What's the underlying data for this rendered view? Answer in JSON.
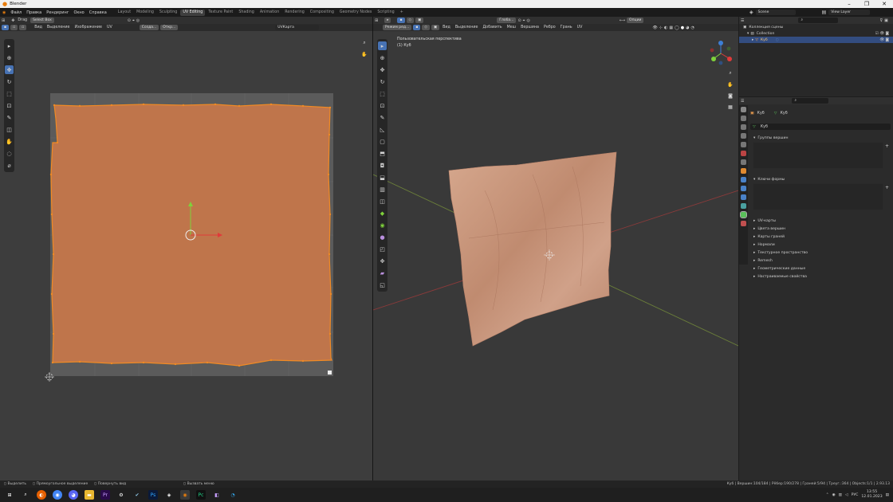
{
  "window": {
    "title": "Blender"
  },
  "menu": [
    "Файл",
    "Правка",
    "Рендеринг",
    "Окно",
    "Справка"
  ],
  "workspaces": [
    {
      "label": "Layout",
      "active": false
    },
    {
      "label": "Modeling",
      "active": false
    },
    {
      "label": "Sculpting",
      "active": false
    },
    {
      "label": "UV Editing",
      "active": true
    },
    {
      "label": "Texture Paint",
      "active": false
    },
    {
      "label": "Shading",
      "active": false
    },
    {
      "label": "Animation",
      "active": false
    },
    {
      "label": "Rendering",
      "active": false
    },
    {
      "label": "Compositing",
      "active": false
    },
    {
      "label": "Geometry Nodes",
      "active": false
    },
    {
      "label": "Scripting",
      "active": false
    }
  ],
  "scene": {
    "name": "Scene",
    "view_layer": "View Layer"
  },
  "uv_editor": {
    "tool_drag": "Drag",
    "tool_select": "Select Box",
    "menus": [
      "Вид",
      "Выделение",
      "Изображение",
      "UV"
    ],
    "snap_label": "Созда...",
    "offset_label": "Откр...",
    "uvmap_name": "UVКарта"
  },
  "viewport": {
    "mode": "Режим ред...",
    "orientation": "Глоба...",
    "options": "Опции",
    "menus": [
      "Вид",
      "Выделение",
      "Добавить",
      "Меш",
      "Вершина",
      "Ребро",
      "Грань",
      "UV"
    ],
    "perspective_label": "Пользовательская перспектива",
    "object_label": "(1) Куб"
  },
  "outliner": {
    "root": "Коллекция сцены",
    "collection": "Collection",
    "object": "Куб"
  },
  "properties": {
    "object_name": "Куб",
    "mesh_name": "Куб",
    "data_name": "Куб",
    "panels_open": [
      "Группы вершин",
      "Ключи формы"
    ],
    "panels_closed": [
      "UV-карты",
      "Цвета вершин",
      "Карты граней",
      "Нормали",
      "Текстурное пространство",
      "Remesh",
      "Геометрические данные",
      "Настраиваемые свойства"
    ]
  },
  "status": {
    "hints": [
      "Выделить",
      "Прямоугольное выделение",
      "Повернуть вид",
      "Вызвать меню"
    ],
    "stats": "Куб | Вершин:104/184 | Рёбер:190/278 | Граней:5/94 | Треуг.:364 | Objects:1/1 | 2.93.13"
  },
  "taskbar": {
    "time": "13:55",
    "date": "12.01.2023",
    "lang": "РУС",
    "apps": [
      "start-icon",
      "search-icon",
      "firefox-icon",
      "chrome-icon",
      "discord-icon",
      "files-icon",
      "premiere-icon",
      "settings-icon",
      "steam-icon",
      "photoshop-icon",
      "unity-icon",
      "blender-icon",
      "pycharm-icon",
      "vs-icon",
      "edge-icon"
    ]
  }
}
